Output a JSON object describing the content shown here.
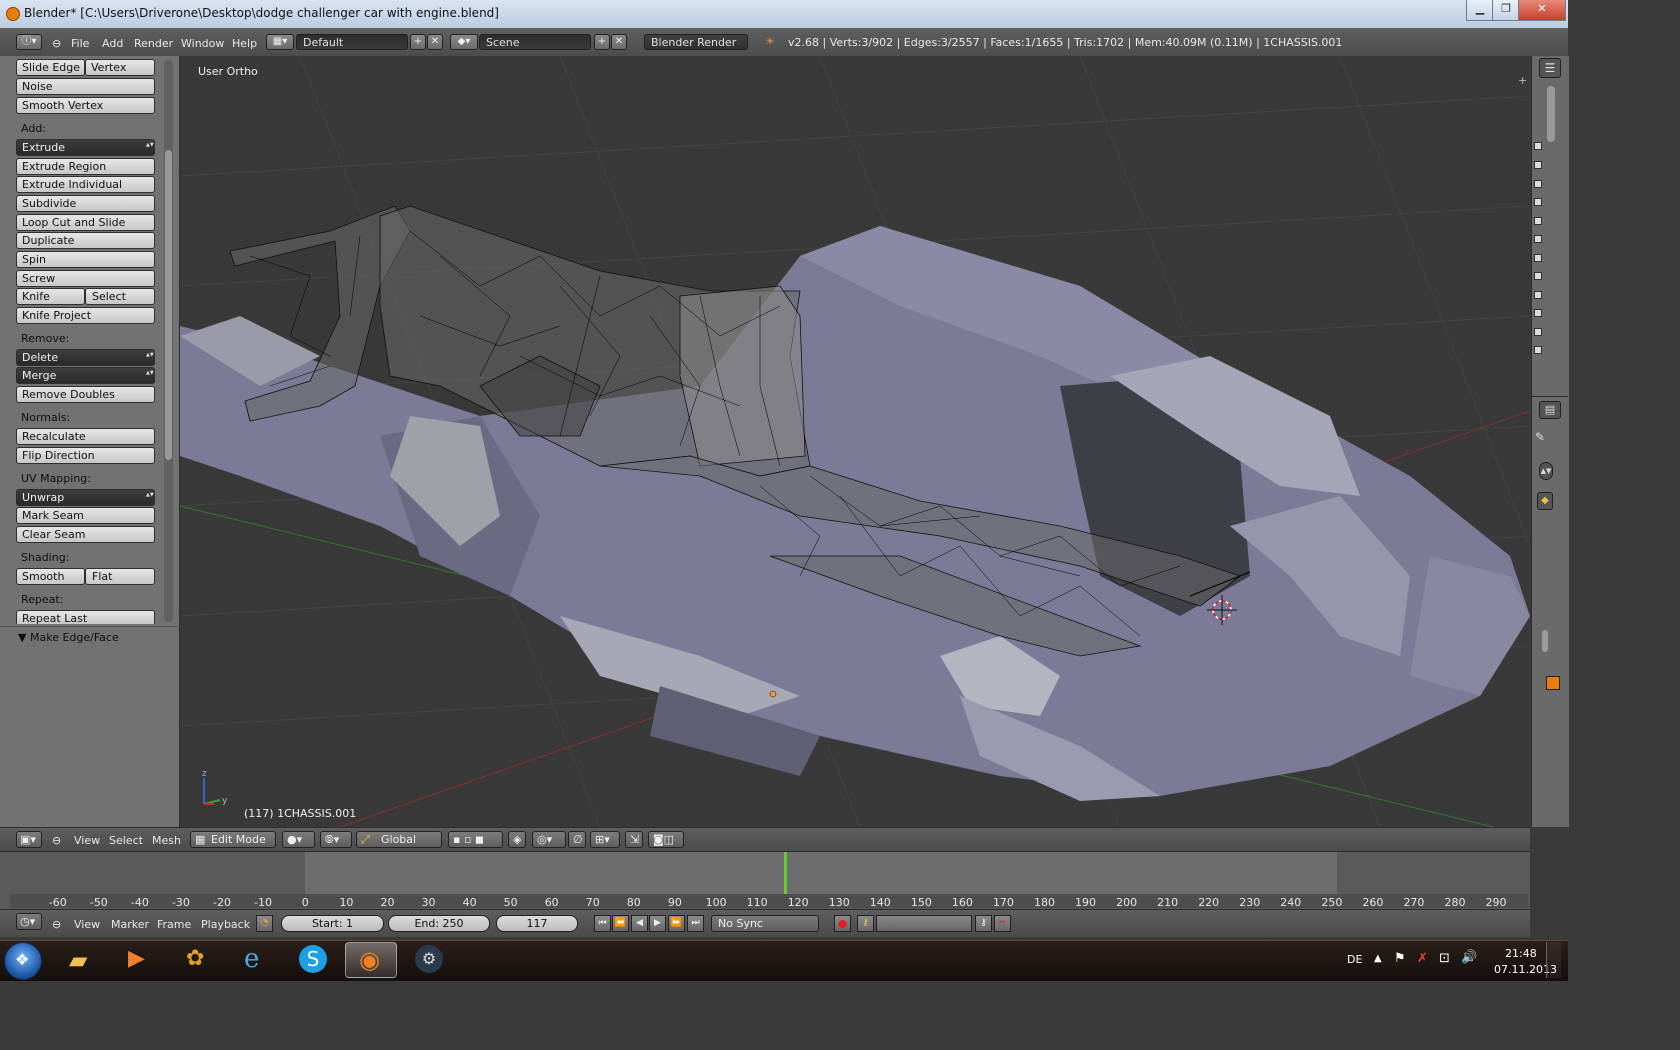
{
  "window": {
    "title": "Blender* [C:\\Users\\Driverone\\Desktop\\dodge challenger  car with engine.blend]",
    "min_label": "▁",
    "max_label": "❐",
    "close_label": "✕"
  },
  "info_header": {
    "menus": [
      "File",
      "Add",
      "Render",
      "Window",
      "Help"
    ],
    "screen_layout": "Default",
    "scene": "Scene",
    "render_engine": "Blender Render",
    "stats": "v2.68 | Verts:3/902 | Edges:3/2557 | Faces:1/1655 | Tris:1702 | Mem:40.09M (0.11M) | 1CHASSIS.001"
  },
  "tool_shelf": {
    "slide_edge": "Slide Edge",
    "vertex": "Vertex",
    "noise": "Noise",
    "smooth_vertex": "Smooth Vertex",
    "add_label": "Add:",
    "extrude": "Extrude",
    "extrude_region": "Extrude Region",
    "extrude_individual": "Extrude Individual",
    "subdivide": "Subdivide",
    "loop_cut": "Loop Cut and Slide",
    "duplicate": "Duplicate",
    "spin": "Spin",
    "screw": "Screw",
    "knife": "Knife",
    "select": "Select",
    "knife_project": "Knife Project",
    "remove_label": "Remove:",
    "delete": "Delete",
    "merge": "Merge",
    "remove_doubles": "Remove Doubles",
    "normals_label": "Normals:",
    "recalculate": "Recalculate",
    "flip_direction": "Flip Direction",
    "uv_label": "UV Mapping:",
    "unwrap": "Unwrap",
    "mark_seam": "Mark Seam",
    "clear_seam": "Clear Seam",
    "shading_label": "Shading:",
    "smooth": "Smooth",
    "flat": "Flat",
    "repeat_label": "Repeat:",
    "repeat_last": "Repeat Last",
    "operator_panel": "Make Edge/Face"
  },
  "viewport": {
    "view_name": "User Ortho",
    "object_info": "(117) 1CHASSIS.001",
    "axis_z": "z",
    "axis_y": "y"
  },
  "view_header": {
    "menus": [
      "View",
      "Select",
      "Mesh"
    ],
    "mode": "Edit Mode",
    "orientation": "Global"
  },
  "timeline": {
    "ticks": [
      "-60",
      "-50",
      "-40",
      "-30",
      "-20",
      "-10",
      "0",
      "10",
      "20",
      "30",
      "40",
      "50",
      "60",
      "70",
      "80",
      "90",
      "100",
      "110",
      "120",
      "130",
      "140",
      "150",
      "160",
      "170",
      "180",
      "190",
      "200",
      "210",
      "220",
      "230",
      "240",
      "250",
      "260",
      "270",
      "280",
      "290"
    ],
    "current_frame": 117,
    "menus": [
      "View",
      "Marker",
      "Frame",
      "Playback"
    ],
    "start": "Start: 1",
    "end": "End: 250",
    "frame": "117",
    "sync": "No Sync"
  },
  "taskbar": {
    "apps": [
      "start-orb",
      "explorer",
      "media-player",
      "app-generic",
      "internet-explorer",
      "skype",
      "blender",
      "steam"
    ],
    "lang": "DE",
    "time": "21:48",
    "date": "07.11.2013"
  },
  "colors": {
    "viewport_bg": "#393939",
    "car_body": "#7c7c98",
    "wire": "#111111",
    "frame_marker": "#66cc33"
  }
}
